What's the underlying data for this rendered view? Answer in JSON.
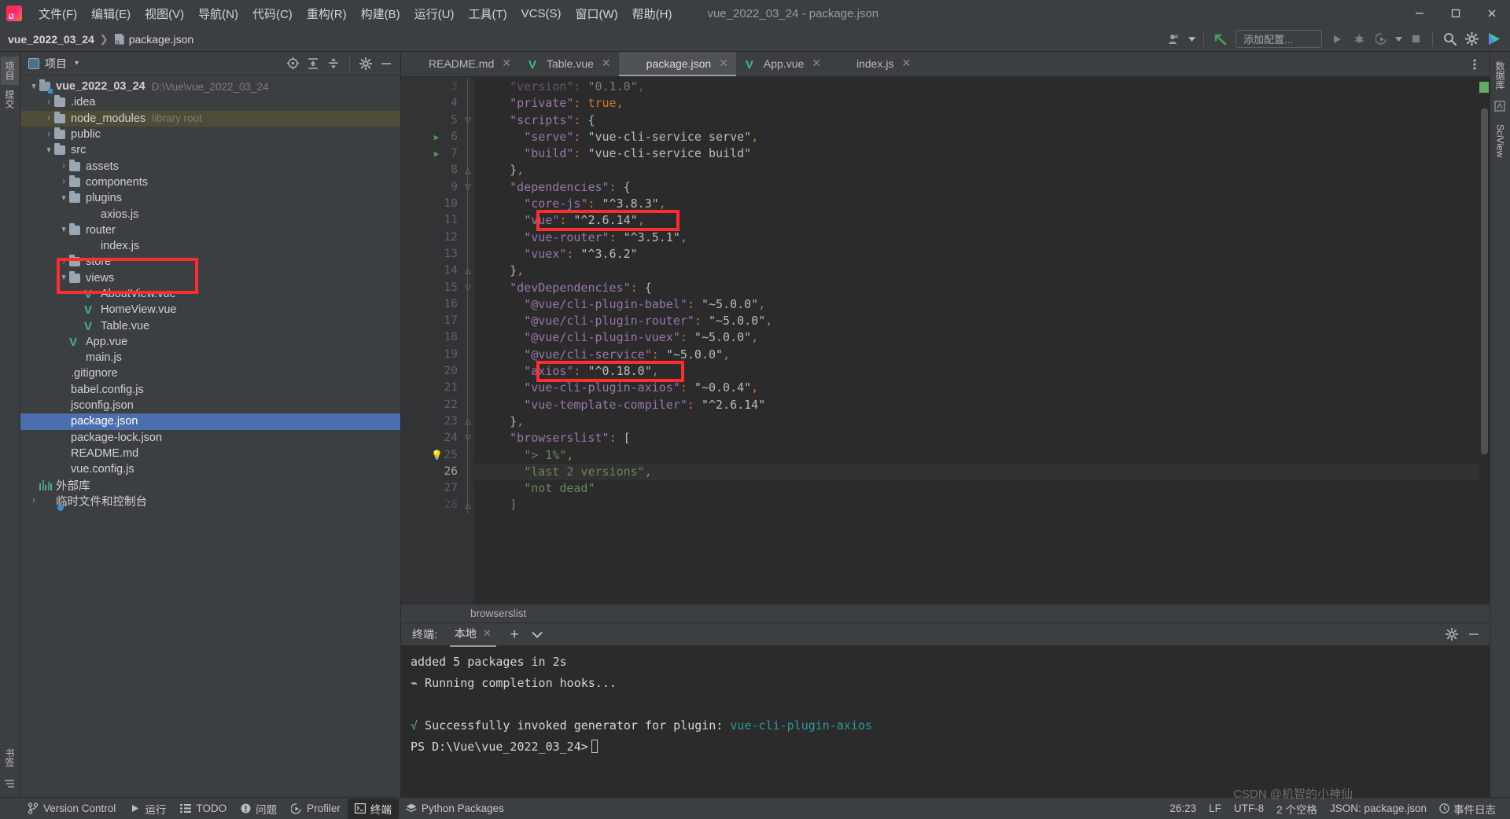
{
  "window": {
    "title": "vue_2022_03_24 - package.json",
    "minimize": "—",
    "maximize": "▢",
    "close": "✕"
  },
  "menubar": {
    "logo": "ij-logo",
    "items": [
      {
        "label": "文件(F)"
      },
      {
        "label": "编辑(E)"
      },
      {
        "label": "视图(V)"
      },
      {
        "label": "导航(N)"
      },
      {
        "label": "代码(C)"
      },
      {
        "label": "重构(R)"
      },
      {
        "label": "构建(B)"
      },
      {
        "label": "运行(U)"
      },
      {
        "label": "工具(T)"
      },
      {
        "label": "VCS(S)"
      },
      {
        "label": "窗口(W)"
      },
      {
        "label": "帮助(H)"
      }
    ]
  },
  "navbar": {
    "project": "vue_2022_03_24",
    "separator": "❯",
    "file": "package.json",
    "run_config_placeholder": "添加配置..."
  },
  "project_panel": {
    "title": "项目",
    "tree": [
      {
        "label": "vue_2022_03_24",
        "dim": "D:\\Vue\\vue_2022_03_24",
        "icon": "module-folder-icon",
        "indent": 0,
        "arrow": "▾",
        "bold": true
      },
      {
        "label": ".idea",
        "dim": "",
        "icon": "folder-icon",
        "indent": 1,
        "arrow": "›"
      },
      {
        "label": "node_modules",
        "dim": "library root",
        "icon": "folder-icon",
        "indent": 1,
        "arrow": "›",
        "highlight": true
      },
      {
        "label": "public",
        "dim": "",
        "icon": "folder-icon",
        "indent": 1,
        "arrow": "›"
      },
      {
        "label": "src",
        "dim": "",
        "icon": "folder-icon",
        "indent": 1,
        "arrow": "▾"
      },
      {
        "label": "assets",
        "dim": "",
        "icon": "folder-icon",
        "indent": 2,
        "arrow": "›"
      },
      {
        "label": "components",
        "dim": "",
        "icon": "folder-icon",
        "indent": 2,
        "arrow": "›"
      },
      {
        "label": "plugins",
        "dim": "",
        "icon": "folder-icon",
        "indent": 2,
        "arrow": "▾"
      },
      {
        "label": "axios.js",
        "dim": "",
        "icon": "js-file-icon",
        "indent": 3,
        "arrow": ""
      },
      {
        "label": "router",
        "dim": "",
        "icon": "folder-icon",
        "indent": 2,
        "arrow": "▾"
      },
      {
        "label": "index.js",
        "dim": "",
        "icon": "js-file-icon",
        "indent": 3,
        "arrow": ""
      },
      {
        "label": "store",
        "dim": "",
        "icon": "folder-icon",
        "indent": 2,
        "arrow": "›"
      },
      {
        "label": "views",
        "dim": "",
        "icon": "folder-icon",
        "indent": 2,
        "arrow": "▾"
      },
      {
        "label": "AboutView.vue",
        "dim": "",
        "icon": "vue-file-icon",
        "indent": 3,
        "arrow": ""
      },
      {
        "label": "HomeView.vue",
        "dim": "",
        "icon": "vue-file-icon",
        "indent": 3,
        "arrow": ""
      },
      {
        "label": "Table.vue",
        "dim": "",
        "icon": "vue-file-icon",
        "indent": 3,
        "arrow": ""
      },
      {
        "label": "App.vue",
        "dim": "",
        "icon": "vue-file-icon",
        "indent": 2,
        "arrow": ""
      },
      {
        "label": "main.js",
        "dim": "",
        "icon": "js-file-icon",
        "indent": 2,
        "arrow": ""
      },
      {
        "label": ".gitignore",
        "dim": "",
        "icon": "gitignore-file-icon",
        "indent": 1,
        "arrow": ""
      },
      {
        "label": "babel.config.js",
        "dim": "",
        "icon": "js-file-icon",
        "indent": 1,
        "arrow": ""
      },
      {
        "label": "jsconfig.json",
        "dim": "",
        "icon": "json-file-icon",
        "indent": 1,
        "arrow": ""
      },
      {
        "label": "package.json",
        "dim": "",
        "icon": "json-file-icon",
        "indent": 1,
        "arrow": "",
        "selected": true
      },
      {
        "label": "package-lock.json",
        "dim": "",
        "icon": "json-file-icon",
        "indent": 1,
        "arrow": ""
      },
      {
        "label": "README.md",
        "dim": "",
        "icon": "md-file-icon",
        "indent": 1,
        "arrow": ""
      },
      {
        "label": "vue.config.js",
        "dim": "",
        "icon": "js-file-icon",
        "indent": 1,
        "arrow": ""
      },
      {
        "label": "外部库",
        "dim": "",
        "icon": "external-libraries-icon",
        "indent": 0,
        "arrow": ""
      },
      {
        "label": "临时文件和控制台",
        "dim": "",
        "icon": "scratches-icon",
        "indent": 0,
        "arrow": "›"
      }
    ]
  },
  "editor": {
    "tabs": [
      {
        "label": "README.md",
        "icon": "md-file-icon",
        "active": false
      },
      {
        "label": "Table.vue",
        "icon": "vue-file-icon",
        "active": false
      },
      {
        "label": "package.json",
        "icon": "json-file-icon",
        "active": true
      },
      {
        "label": "App.vue",
        "icon": "vue-file-icon",
        "active": false
      },
      {
        "label": "index.js",
        "icon": "js-file-icon",
        "active": false
      }
    ],
    "breadcrumb": "browserslist",
    "lines": [
      {
        "num": 3,
        "text": "    \"version\": \"0.1.0\",",
        "clipped": true
      },
      {
        "num": 4,
        "text": "    \"private\": true,"
      },
      {
        "num": 5,
        "text": "    \"scripts\": {",
        "fold": "▽"
      },
      {
        "num": 6,
        "text": "      \"serve\": \"vue-cli-service serve\",",
        "gutter_icon": "run-triangle-icon"
      },
      {
        "num": 7,
        "text": "      \"build\": \"vue-cli-service build\"",
        "gutter_icon": "run-triangle-icon"
      },
      {
        "num": 8,
        "text": "    },",
        "fold": "△"
      },
      {
        "num": 9,
        "text": "    \"dependencies\": {",
        "fold": "▽"
      },
      {
        "num": 10,
        "text": "      \"core-js\": \"^3.8.3\","
      },
      {
        "num": 11,
        "text": "      \"vue\": \"^2.6.14\",",
        "highlight_box": true
      },
      {
        "num": 12,
        "text": "      \"vue-router\": \"^3.5.1\","
      },
      {
        "num": 13,
        "text": "      \"vuex\": \"^3.6.2\""
      },
      {
        "num": 14,
        "text": "    },",
        "fold": "△"
      },
      {
        "num": 15,
        "text": "    \"devDependencies\": {",
        "fold": "▽"
      },
      {
        "num": 16,
        "text": "      \"@vue/cli-plugin-babel\": \"~5.0.0\","
      },
      {
        "num": 17,
        "text": "      \"@vue/cli-plugin-router\": \"~5.0.0\","
      },
      {
        "num": 18,
        "text": "      \"@vue/cli-plugin-vuex\": \"~5.0.0\","
      },
      {
        "num": 19,
        "text": "      \"@vue/cli-service\": \"~5.0.0\","
      },
      {
        "num": 20,
        "text": "      \"axios\": \"^0.18.0\",",
        "highlight_box": true
      },
      {
        "num": 21,
        "text": "      \"vue-cli-plugin-axios\": \"~0.0.4\","
      },
      {
        "num": 22,
        "text": "      \"vue-template-compiler\": \"^2.6.14\""
      },
      {
        "num": 23,
        "text": "    },",
        "fold": "△"
      },
      {
        "num": 24,
        "text": "    \"browserslist\": [",
        "fold": "▽"
      },
      {
        "num": 25,
        "text": "      \"> 1%\",",
        "gutter_icon": "bulb-icon"
      },
      {
        "num": 26,
        "text": "      \"last 2 versions\",",
        "current": true
      },
      {
        "num": 27,
        "text": "      \"not dead\""
      },
      {
        "num": 28,
        "text": "    ]",
        "fold": "△",
        "clipped": true
      }
    ]
  },
  "terminal": {
    "label": "终端:",
    "tab": "本地",
    "add": "+",
    "chevron": "⌄",
    "lines": [
      {
        "text": "added 5 packages in 2s",
        "color": "normal"
      },
      {
        "prefix": "⌁",
        "text": " Running completion hooks...",
        "color": "normal"
      },
      {
        "text": "",
        "color": "normal"
      },
      {
        "prefix": "√",
        "text": " Successfully invoked generator for plugin: ",
        "suffix": "vue-cli-plugin-axios",
        "color": "green-check"
      },
      {
        "text": "PS D:\\Vue\\vue_2022_03_24>",
        "color": "normal",
        "cursor": true
      }
    ]
  },
  "statusbar": {
    "items": [
      {
        "label": "Version Control",
        "icon": "branch-icon"
      },
      {
        "label": "运行",
        "icon": "run-icon"
      },
      {
        "label": "TODO",
        "icon": "todo-icon"
      },
      {
        "label": "问题",
        "icon": "problems-icon"
      },
      {
        "label": "Profiler",
        "icon": "profiler-icon"
      },
      {
        "label": "终端",
        "icon": "terminal-icon",
        "active": true
      },
      {
        "label": "Python Packages",
        "icon": "packages-icon"
      }
    ],
    "caret": "26:23",
    "line_sep": "LF",
    "encoding": "UTF-8",
    "indent": "2 个空格",
    "file_type": "JSON: package.json",
    "event_log": "事件日志",
    "watermark": "CSDN @机智的小神仙"
  },
  "rails": {
    "left": [
      "项目",
      "提交",
      "结构",
      "书签"
    ],
    "right": [
      "数据库",
      "Maven",
      "SciView"
    ]
  },
  "colors": {
    "accent_blue": "#4b6eaf",
    "annotation_red": "#ff2d2d",
    "string_green": "#6a8759",
    "key_purple": "#9876aa",
    "punct_orange": "#cc7832",
    "vue_green": "#42b883"
  }
}
